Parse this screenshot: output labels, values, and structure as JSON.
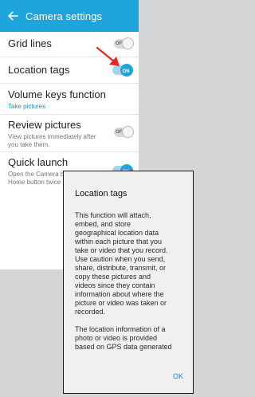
{
  "header": {
    "title": "Camera settings"
  },
  "rows": [
    {
      "title": "Grid lines",
      "toggle": "OFF"
    },
    {
      "title": "Location tags",
      "toggle": "ON"
    },
    {
      "title": "Volume keys function",
      "subtitle": "Take pictures"
    },
    {
      "title": "Review pictures",
      "subtitle": "View pictures immediately after you take them.",
      "toggle": "OFF"
    },
    {
      "title": "Quick launch",
      "subtitle_line1": "Open the Camera b",
      "subtitle_line2": "Home button twice",
      "toggle": "ON"
    }
  ],
  "dialog": {
    "title": "Location tags",
    "paragraph1": "This function will attach, embed, and store geographical location data within each picture that you take or video that you record. Use caution when you send, share, distribute, transmit, or copy these pictures and videos since they contain information about where the picture or video was taken or recorded.",
    "paragraph2": "The location information of a photo or video is provided based on GPS data generated",
    "ok_label": "OK"
  },
  "colors": {
    "accent": "#1fa4dc",
    "annotation_arrow": "#e8262a"
  },
  "icons": {
    "back": "back-arrow-icon",
    "annotation": "red-arrow-icon"
  }
}
